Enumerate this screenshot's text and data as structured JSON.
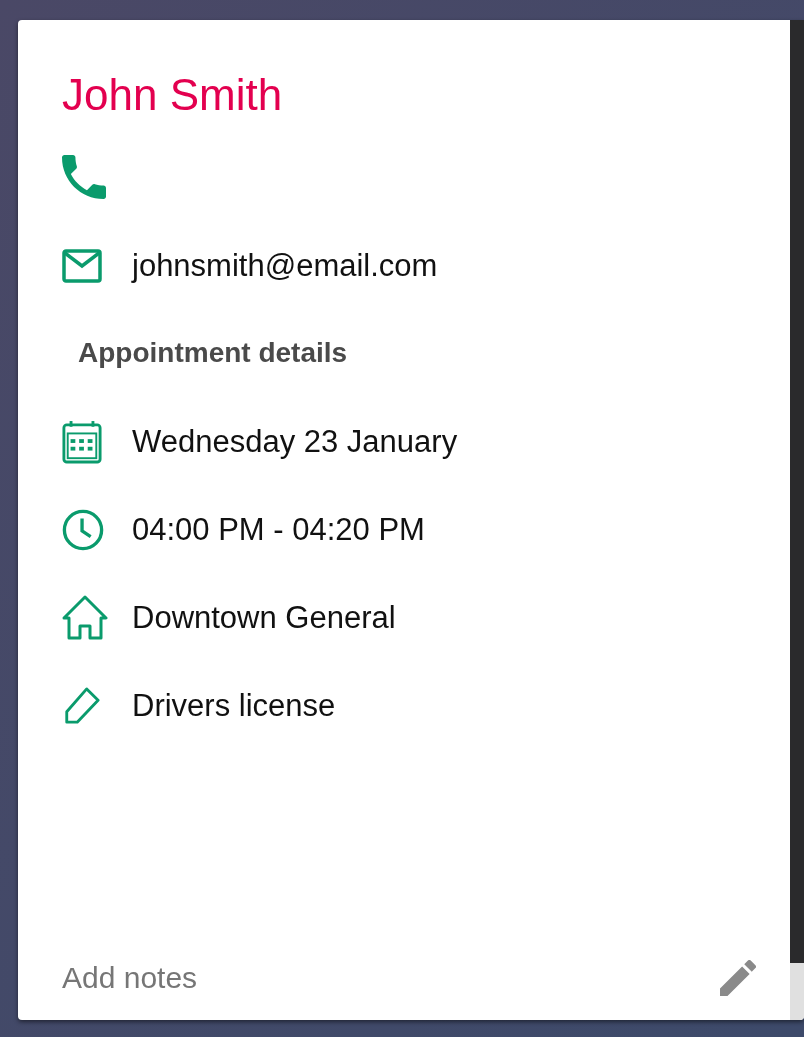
{
  "contact": {
    "name": "John Smith",
    "email": "johnsmith@email.com"
  },
  "appointment": {
    "heading": "Appointment details",
    "details": [
      {
        "kind": "date",
        "text": "Wednesday 23 January"
      },
      {
        "kind": "time",
        "text": "04:00 PM - 04:20 PM"
      },
      {
        "kind": "location",
        "text": "Downtown General"
      },
      {
        "kind": "tag",
        "text": "Drivers license"
      }
    ]
  },
  "notes": {
    "placeholder": "Add notes"
  }
}
